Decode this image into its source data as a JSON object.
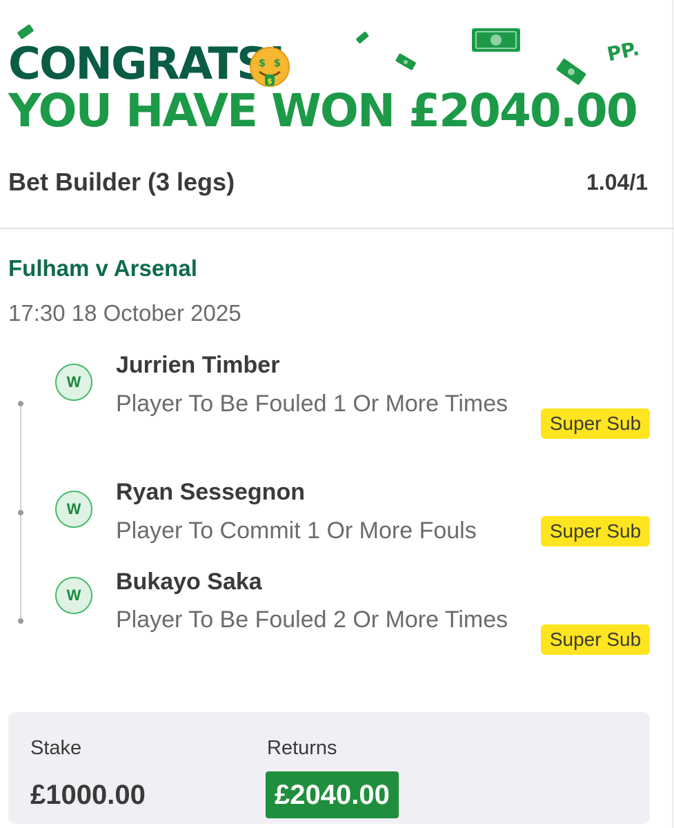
{
  "banner": {
    "headline": "CONGRATS!",
    "subheadline": "YOU HAVE WON £2040.00",
    "emoji": "money-mouth-face",
    "brand_mark": "PP."
  },
  "bet": {
    "title": "Bet Builder (3 legs)",
    "odds": "1.04/1"
  },
  "event": {
    "match": "Fulham v Arsenal",
    "datetime": "17:30 18 October 2025"
  },
  "legs": [
    {
      "result": "W",
      "player": "Jurrien Timber",
      "market": "Player To Be Fouled 1 Or More Times",
      "tag": "Super Sub"
    },
    {
      "result": "W",
      "player": "Ryan Sessegnon",
      "market": "Player To Commit 1 Or More Fouls",
      "tag": "Super Sub"
    },
    {
      "result": "W",
      "player": "Bukayo Saka",
      "market": "Player To Be Fouled 2 Or More Times",
      "tag": "Super Sub"
    }
  ],
  "summary": {
    "stake_label": "Stake",
    "stake_value": "£1000.00",
    "returns_label": "Returns",
    "returns_value": "£2040.00"
  },
  "colors": {
    "brand_dark_green": "#0a5c45",
    "brand_green": "#1c9a48",
    "super_sub_yellow": "#ffe51f",
    "returns_green": "#1f8f3d"
  }
}
